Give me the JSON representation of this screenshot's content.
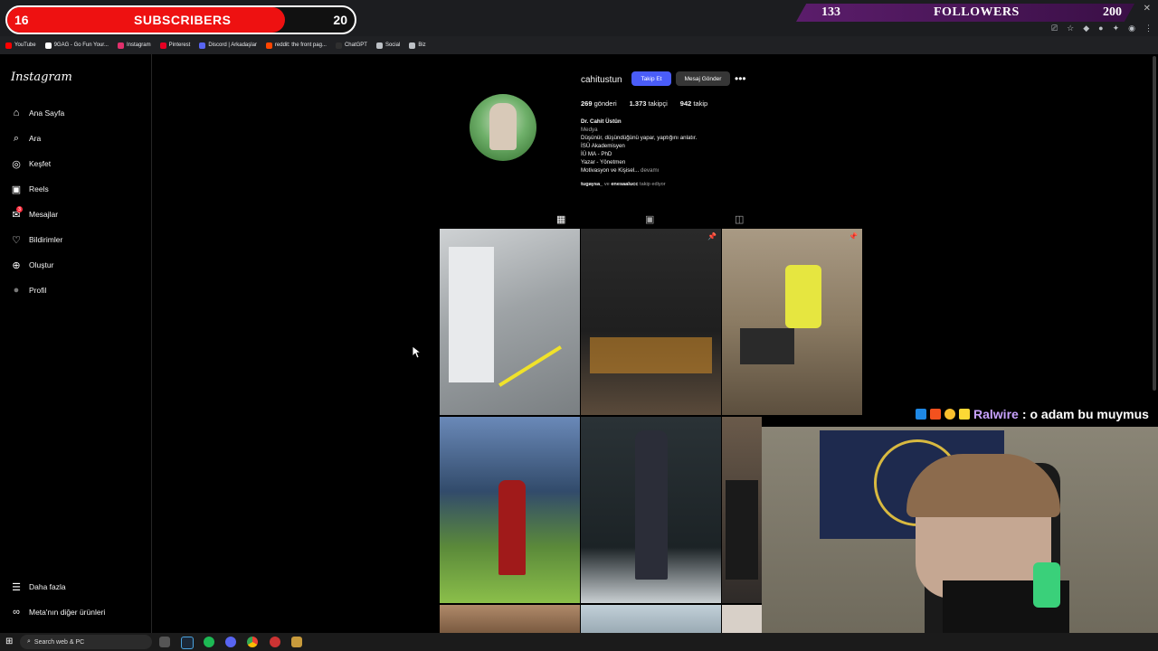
{
  "overlay": {
    "subscribers": {
      "label": "SUBSCRIBERS",
      "current": "16",
      "goal": "20",
      "progress": 0.8
    },
    "followers": {
      "label": "FOLLOWERS",
      "current": "133",
      "goal": "200",
      "progress": 0.665
    }
  },
  "browser": {
    "bookmarks": [
      {
        "label": "YouTube",
        "icon": "youtube-icon",
        "color": "#ff0000"
      },
      {
        "label": "9GAG - Go Fun Your...",
        "icon": "9gag-icon",
        "color": "#ffffff"
      },
      {
        "label": "Instagram",
        "icon": "instagram-icon",
        "color": "#e1306c"
      },
      {
        "label": "Pinterest",
        "icon": "pinterest-icon",
        "color": "#e60023"
      },
      {
        "label": "Discord | Arkadaşlar",
        "icon": "discord-icon",
        "color": "#5865f2"
      },
      {
        "label": "reddit: the front pag...",
        "icon": "reddit-icon",
        "color": "#ff4500"
      },
      {
        "label": "ChatGPT",
        "icon": "chatgpt-icon",
        "color": "#2f2f2f"
      },
      {
        "label": "Social",
        "icon": "folder-icon",
        "color": "#bdc1c6"
      },
      {
        "label": "Biz",
        "icon": "folder-icon",
        "color": "#bdc1c6"
      }
    ]
  },
  "instagram": {
    "logo": "Instagram",
    "nav": [
      {
        "label": "Ana Sayfa",
        "icon": "home-icon"
      },
      {
        "label": "Ara",
        "icon": "search-icon"
      },
      {
        "label": "Keşfet",
        "icon": "explore-icon"
      },
      {
        "label": "Reels",
        "icon": "reels-icon"
      },
      {
        "label": "Mesajlar",
        "icon": "messages-icon",
        "badge": "3"
      },
      {
        "label": "Bildirimler",
        "icon": "heart-icon"
      },
      {
        "label": "Oluştur",
        "icon": "create-icon"
      },
      {
        "label": "Profil",
        "icon": "avatar"
      }
    ],
    "bottom_nav": [
      {
        "label": "Daha fazla",
        "icon": "menu-icon"
      },
      {
        "label": "Meta'nın diğer ürünleri",
        "icon": "meta-icon"
      }
    ],
    "profile": {
      "username": "cahitustun",
      "follow_label": "Takip Et",
      "message_label": "Mesaj Gönder",
      "stats": [
        {
          "value": "269",
          "label": "gönderi"
        },
        {
          "value": "1.373",
          "label": "takipçi"
        },
        {
          "value": "942",
          "label": "takip"
        }
      ],
      "bio_name": "Dr. Cahit Üstün",
      "bio_category": "Medya",
      "bio_lines": [
        "Düşünür, düşündüğünü yapar, yaptığını anlatır.",
        "İSÜ Akademisyen",
        "İÜ MA - PhD",
        "Yazar - Yönetmen"
      ],
      "bio_last": "Motivasyon ve Kişisel...",
      "bio_more": "devamı",
      "followed_by_user1": "tugaysa_",
      "followed_by_and": "ve",
      "followed_by_user2": "enesaalucc",
      "followed_by_suffix": "takip ediyor"
    }
  },
  "chat": {
    "user": "Ralwire",
    "separator": ":",
    "message": "o adam bu muymus"
  },
  "taskbar": {
    "search_placeholder": "Search web & PC"
  }
}
